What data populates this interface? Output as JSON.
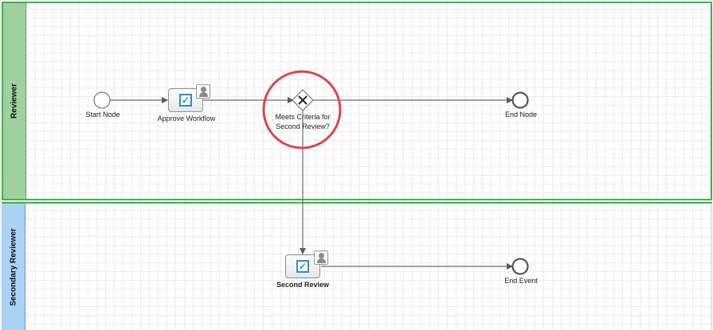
{
  "lanes": {
    "reviewer": "Reviewer",
    "secondary": "Secondary Reviewer"
  },
  "nodes": {
    "start": "Start Node",
    "approve": "Approve Workflow",
    "gateway_line1": "Meets Criteria for",
    "gateway_line2": "Second Review?",
    "end_node": "End Node",
    "second_review": "Second Review",
    "end_event": "End Event"
  },
  "colors": {
    "reviewer_lane": "#9ed19f",
    "secondary_lane": "#a9d3f2",
    "lane_border": "#39b54a",
    "highlight_circle": "#d9474a",
    "task_check": "#2a8fc7"
  },
  "icons": {
    "task": "check-icon",
    "assignee": "user-icon",
    "gateway": "exclusive-gateway-x-icon"
  }
}
